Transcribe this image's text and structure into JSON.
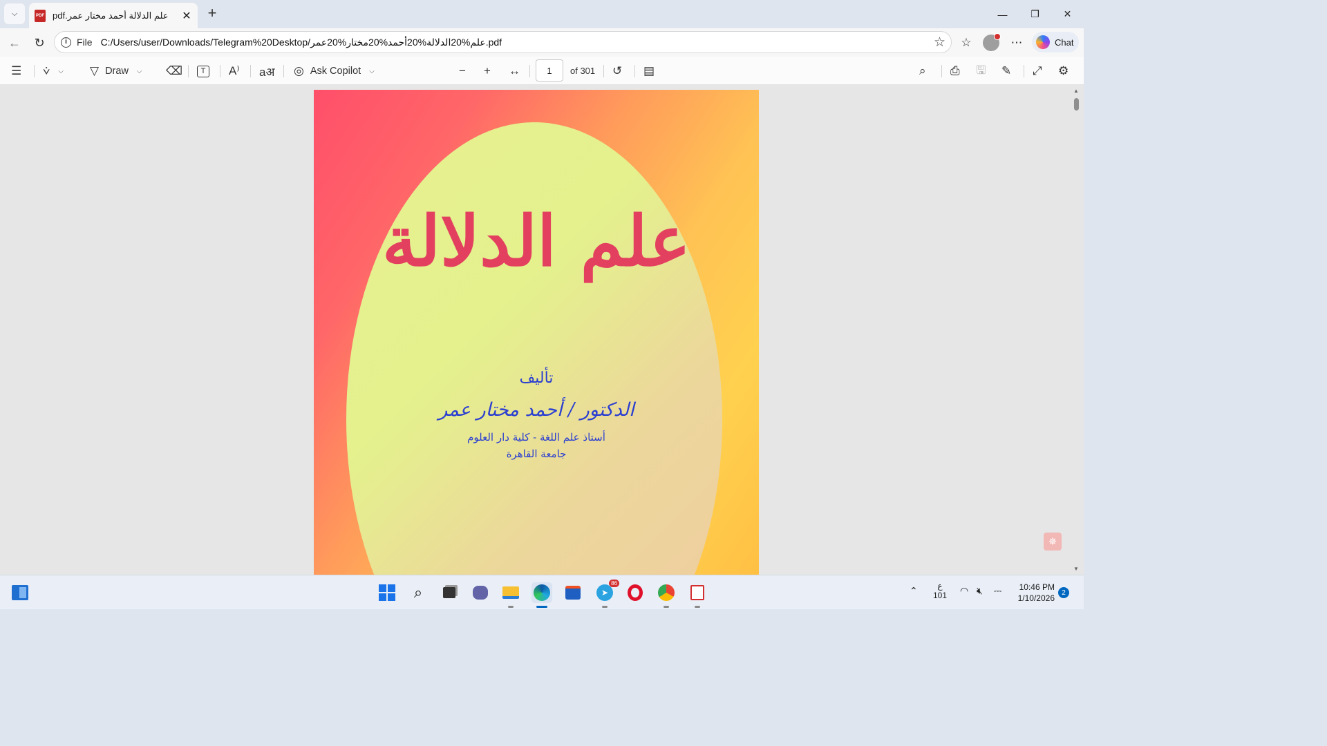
{
  "tab": {
    "title": "علم الدلالة أحمد مختار عمر.pdf",
    "close_icon": "✕",
    "new_tab_icon": "+"
  },
  "window": {
    "minimize": "—",
    "restore": "❐",
    "close": "✕"
  },
  "address": {
    "scheme_label": "File",
    "url": "C:/Users/user/Downloads/Telegram%20Desktop/علم%20الدلالة%20أحمد%20مختار%20عمر.pdf"
  },
  "chat_label": "Chat",
  "pdf_toolbar": {
    "draw_label": "Draw",
    "ask_copilot_label": "Ask Copilot",
    "current_page": "1",
    "total_pages_label": "of 301"
  },
  "document": {
    "title": "علم الدلالة",
    "author_intro": "تأليف",
    "author_name": "الدكتور / أحمد مختار عمر",
    "author_position": "أستاذ علم اللغة - كلية دار العلوم",
    "university": "جامعة القاهرة"
  },
  "taskbar": {
    "notification_badge": "86",
    "input_lang_top": "ع",
    "input_lang_bottom": "101",
    "time": "10:46 PM",
    "date": "1/10/2026",
    "notification_count": "2"
  },
  "colors": {
    "accent": "#0067c0",
    "cover_title": "#e34060",
    "cover_author": "#2b3fd0"
  }
}
